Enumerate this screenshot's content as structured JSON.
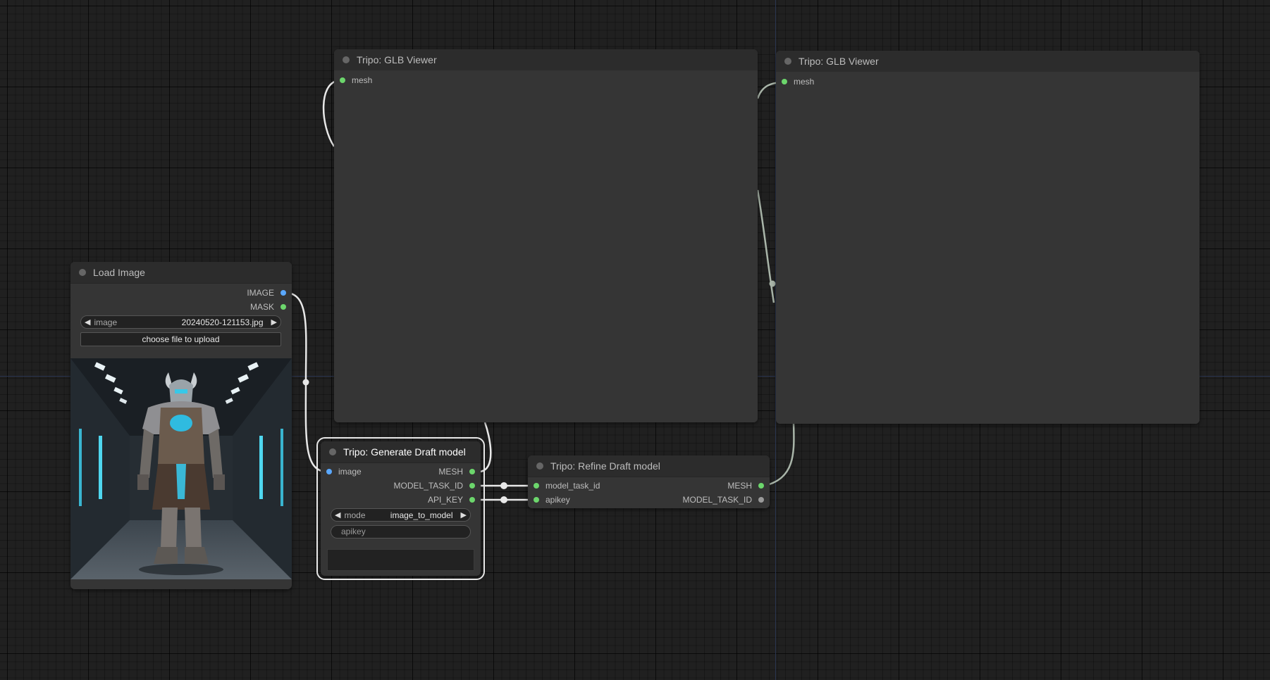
{
  "nodes": {
    "load_image": {
      "title": "Load Image",
      "outputs": [
        "IMAGE",
        "MASK"
      ],
      "image_widget": {
        "label": "image",
        "value": "20240520-121153.jpg"
      },
      "upload_button": "choose file to upload",
      "preview_alt": "armored horned warrior in sci-fi corridor"
    },
    "glb_viewer_1": {
      "title": "Tripo: GLB Viewer",
      "inputs": [
        "mesh"
      ]
    },
    "glb_viewer_2": {
      "title": "Tripo: GLB Viewer",
      "inputs": [
        "mesh"
      ]
    },
    "generate_draft": {
      "title": "Tripo: Generate Draft model",
      "inputs": [
        "image"
      ],
      "outputs": [
        "MESH",
        "MODEL_TASK_ID",
        "API_KEY"
      ],
      "mode_widget": {
        "label": "mode",
        "value": "image_to_model"
      },
      "apikey_placeholder": "apikey"
    },
    "refine_draft": {
      "title": "Tripo: Refine Draft model",
      "inputs": [
        "model_task_id",
        "apikey"
      ],
      "outputs": [
        "MESH",
        "MODEL_TASK_ID"
      ]
    }
  },
  "colors": {
    "socket_green": "#6cd66c",
    "socket_blue": "#5aa8ff",
    "socket_grey": "#9a9a9a",
    "wire": "#e8e8e8",
    "wire_dim": "#a9b5a9"
  }
}
